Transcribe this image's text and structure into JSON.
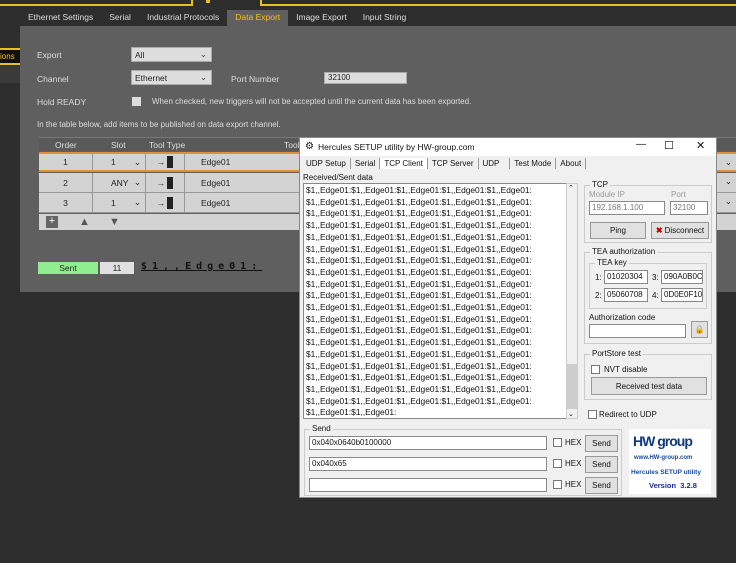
{
  "main_tabs": [
    "Ethernet Settings",
    "Serial",
    "Industrial Protocols",
    "Data Export",
    "Image Export",
    "Input String"
  ],
  "side_label": "ions",
  "form": {
    "export_label": "Export",
    "export_value": "All",
    "channel_label": "Channel",
    "channel_value": "Ethernet",
    "port_label": "Port Number",
    "port_value": "32100",
    "hold_label": "Hold READY",
    "hold_desc": "When checked, new triggers will not be accepted until the current data has been exported.",
    "table_hint": "In the table below, add items to be published on data export channel."
  },
  "table": {
    "headers": [
      "Order",
      "Slot",
      "Tool Type",
      "Tool"
    ],
    "rows": [
      {
        "order": "1",
        "slot": "1",
        "tool": "Edge01"
      },
      {
        "order": "2",
        "slot": "ANY",
        "tool": "Edge01"
      },
      {
        "order": "3",
        "slot": "1",
        "tool": "Edge01"
      }
    ]
  },
  "status": {
    "sent_label": "Sent",
    "count": "11",
    "data": "$1,,Edge01:"
  },
  "hercules": {
    "title": "Hercules SETUP utility by HW-group.com",
    "tabs": [
      "UDP Setup",
      "Serial",
      "TCP Client",
      "TCP Server",
      "UDP",
      "Test Mode",
      "About"
    ],
    "received_label": "Received/Sent data",
    "received_text": "$1,,Edge01:$1,,Edge01:$1,,Edge01:$1,,Edge01:$1,,Edge01:\n$1,,Edge01:$1,,Edge01:$1,,Edge01:$1,,Edge01:$1,,Edge01:\n$1,,Edge01:$1,,Edge01:$1,,Edge01:$1,,Edge01:$1,,Edge01:\n$1,,Edge01:$1,,Edge01:$1,,Edge01:$1,,Edge01:$1,,Edge01:\n$1,,Edge01:$1,,Edge01:$1,,Edge01:$1,,Edge01:$1,,Edge01:\n$1,,Edge01:$1,,Edge01:$1,,Edge01:$1,,Edge01:$1,,Edge01:\n$1,,Edge01:$1,,Edge01:$1,,Edge01:$1,,Edge01:$1,,Edge01:\n$1,,Edge01:$1,,Edge01:$1,,Edge01:$1,,Edge01:$1,,Edge01:\n$1,,Edge01:$1,,Edge01:$1,,Edge01:$1,,Edge01:$1,,Edge01:\n$1,,Edge01:$1,,Edge01:$1,,Edge01:$1,,Edge01:$1,,Edge01:\n$1,,Edge01:$1,,Edge01:$1,,Edge01:$1,,Edge01:$1,,Edge01:\n$1,,Edge01:$1,,Edge01:$1,,Edge01:$1,,Edge01:$1,,Edge01:\n$1,,Edge01:$1,,Edge01:$1,,Edge01:$1,,Edge01:$1,,Edge01:\n$1,,Edge01:$1,,Edge01:$1,,Edge01:$1,,Edge01:$1,,Edge01:\n$1,,Edge01:$1,,Edge01:$1,,Edge01:$1,,Edge01:$1,,Edge01:\n$1,,Edge01:$1,,Edge01:$1,,Edge01:$1,,Edge01:$1,,Edge01:\n$1,,Edge01:$1,,Edge01:$1,,Edge01:$1,,Edge01:$1,,Edge01:\n$1,,Edge01:$1,,Edge01:$1,,Edge01:$1,,Edge01:$1,,Edge01:\n$1,,Edge01:$1,,Edge01:$1,,Edge01:$1,,Edge01:$1,,Edge01:\n$1,,Edge01:$1,,Edge01:",
    "tcp": {
      "label": "TCP",
      "module_ip_label": "Module IP",
      "module_ip": "192.168.1.100",
      "port_label": "Port",
      "port": "32100",
      "ping": "Ping",
      "disconnect": "Disconnect"
    },
    "tea": {
      "label": "TEA authorization",
      "key_label": "TEA key",
      "k1_label": "1:",
      "k1": "01020304",
      "k2_label": "2:",
      "k2": "05060708",
      "k3_label": "3:",
      "k3": "090A0B0C",
      "k4_label": "4:",
      "k4": "0D0E0F10",
      "auth_label": "Authorization code",
      "auth_value": ""
    },
    "portstore": {
      "label": "PortStore test",
      "nvt": "NVT disable",
      "received_test": "Received test data"
    },
    "redirect": "Redirect to UDP",
    "send": {
      "label": "Send",
      "rows": [
        {
          "value": "0x040x0640b0100000",
          "hex": "HEX",
          "button": "Send"
        },
        {
          "value": "0x040x65",
          "hex": "HEX",
          "button": "Send"
        },
        {
          "value": "",
          "hex": "HEX",
          "button": "Send"
        }
      ]
    },
    "logo": {
      "brand": "HW group",
      "url": "www.HW-group.com",
      "product": "Hercules SETUP utility",
      "version": "Version  3.2.8"
    }
  }
}
